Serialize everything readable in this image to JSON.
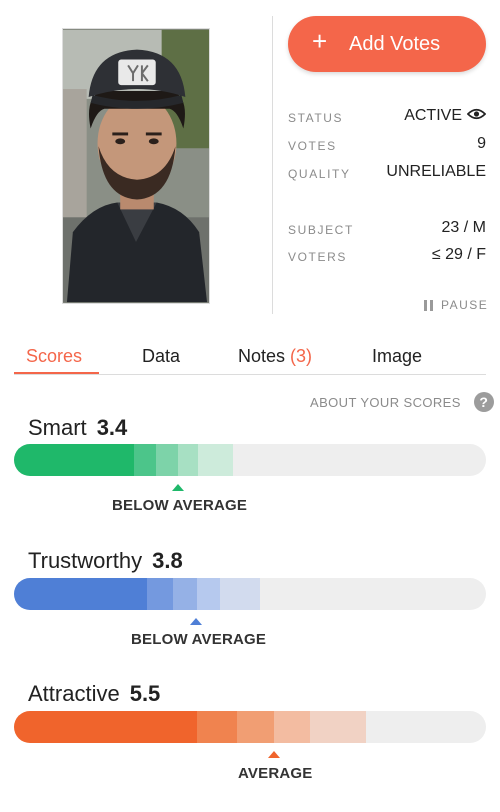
{
  "profile": {
    "photo_alt": "subject photo",
    "add_votes_label": "Add Votes",
    "status_label": "STATUS",
    "status_value": "ACTIVE",
    "votes_label": "VOTES",
    "votes_value": "9",
    "quality_label": "QUALITY",
    "quality_value": "UNRELIABLE",
    "subject_label": "SUBJECT",
    "subject_value": "23 / M",
    "voters_label": "VOTERS",
    "voters_value": "≤ 29 / F",
    "pause_label": "PAUSE"
  },
  "tabs": [
    {
      "label": "Scores",
      "active": true
    },
    {
      "label": "Data"
    },
    {
      "label": "Notes",
      "count": "(3)"
    },
    {
      "label": "Image"
    }
  ],
  "about_scores_label": "ABOUT YOUR SCORES",
  "scores": [
    {
      "name": "Smart",
      "value": "3.4",
      "verdict": "BELOW AVERAGE",
      "color": "#1fb86a"
    },
    {
      "name": "Trustworthy",
      "value": "3.8",
      "verdict": "BELOW AVERAGE",
      "color": "#4f7fd6"
    },
    {
      "name": "Attractive",
      "value": "5.5",
      "verdict": "AVERAGE",
      "color": "#f0642c"
    }
  ],
  "colors": {
    "accent": "#f4664a",
    "smart": "#1fb86a",
    "trustworthy": "#4f7fd6",
    "attractive": "#f0642c"
  },
  "icons": [
    "plus-icon",
    "eye-icon",
    "pause-icon",
    "help-icon"
  ]
}
